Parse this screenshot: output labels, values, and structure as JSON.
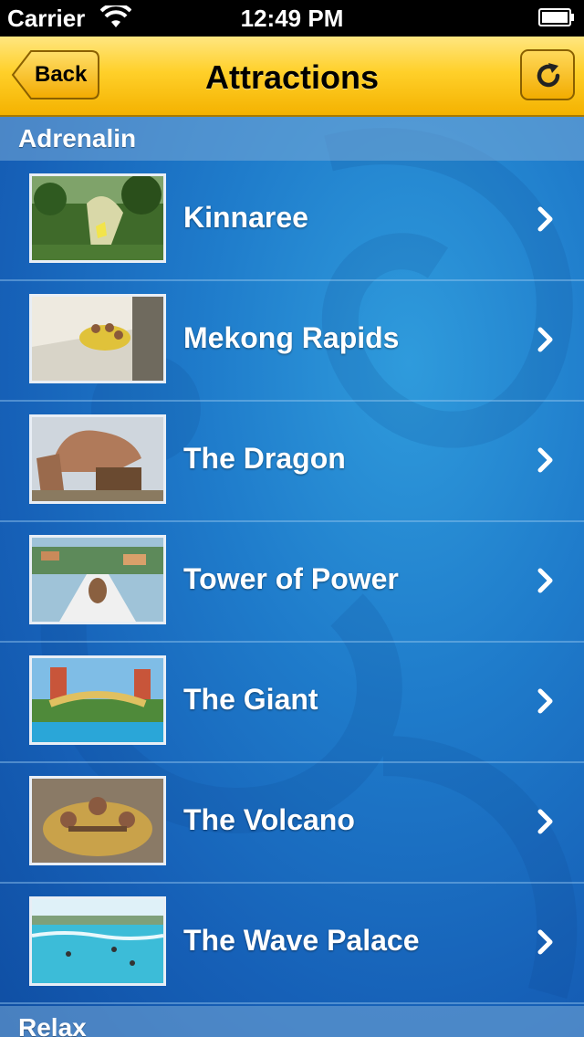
{
  "status_bar": {
    "carrier": "Carrier",
    "time": "12:49 PM"
  },
  "nav": {
    "back_label": "Back",
    "title": "Attractions",
    "refresh_icon": "refresh-icon"
  },
  "sections": [
    {
      "title": "Adrenalin",
      "items": [
        {
          "label": "Kinnaree",
          "thumb": "slide-jungle"
        },
        {
          "label": "Mekong Rapids",
          "thumb": "raft-slide"
        },
        {
          "label": "The Dragon",
          "thumb": "dragon-statue"
        },
        {
          "label": "Tower of Power",
          "thumb": "tower-slide"
        },
        {
          "label": "The Giant",
          "thumb": "giant-pool"
        },
        {
          "label": "The Volcano",
          "thumb": "volcano-raft"
        },
        {
          "label": "The Wave Palace",
          "thumb": "wave-pool"
        }
      ]
    },
    {
      "title": "Relax",
      "items": []
    }
  ],
  "colors": {
    "nav_gradient_top": "#ffe680",
    "nav_gradient_bottom": "#f4b200",
    "background": "#1f7ccb",
    "row_text": "#ffffff"
  }
}
